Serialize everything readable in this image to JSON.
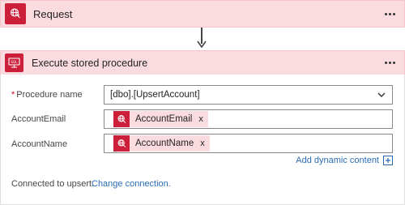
{
  "request_card": {
    "title": "Request",
    "icon": "globe-icon"
  },
  "sp_card": {
    "title": "Execute stored procedure",
    "icon": "sql-database-icon",
    "fields": {
      "procedure": {
        "label": "Procedure name",
        "required_mark": "*",
        "value": "[dbo].[UpsertAccount]"
      },
      "email": {
        "label": "AccountEmail",
        "token": "AccountEmail",
        "token_icon": "globe-icon"
      },
      "name": {
        "label": "AccountName",
        "token": "AccountName",
        "token_icon": "globe-icon"
      }
    },
    "remove_glyph": "x",
    "add_dynamic_content": "Add dynamic content",
    "connection_text": "Connected to upsert.",
    "change_connection": "Change connection."
  },
  "colors": {
    "brand_red": "#cc1f3a",
    "header_pink": "#f9dbe0",
    "link_blue": "#2b6cb5"
  }
}
